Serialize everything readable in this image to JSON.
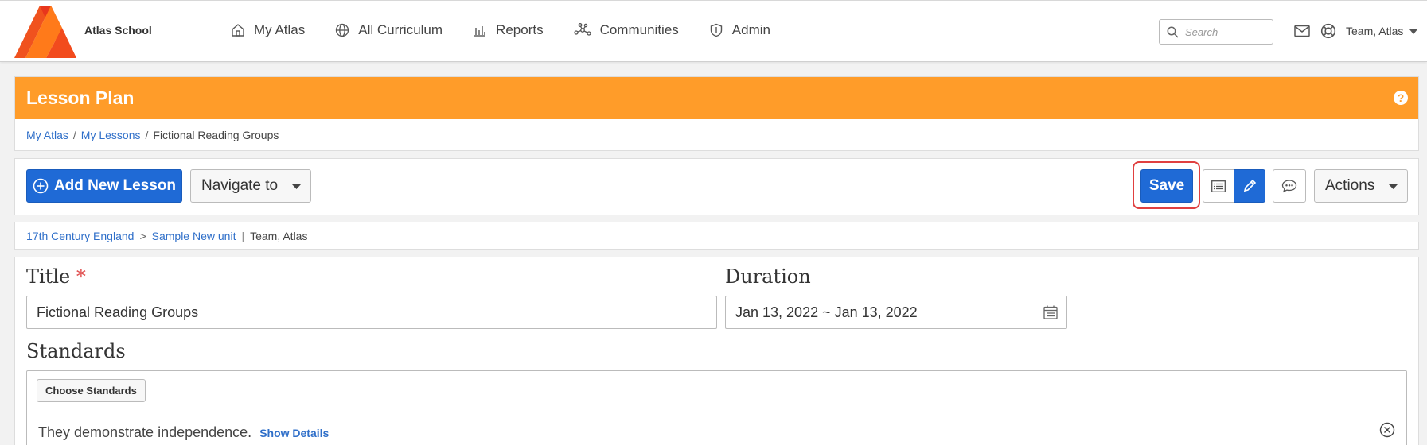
{
  "brand": {
    "school_name": "Atlas School",
    "logo_colors": [
      "#e8361c",
      "#ff7a1a"
    ]
  },
  "nav": {
    "items": [
      {
        "label": "My Atlas",
        "icon": "home-icon"
      },
      {
        "label": "All Curriculum",
        "icon": "globe-icon"
      },
      {
        "label": "Reports",
        "icon": "bar-chart-icon"
      },
      {
        "label": "Communities",
        "icon": "network-icon"
      },
      {
        "label": "Admin",
        "icon": "shield-icon"
      }
    ],
    "search_placeholder": "Search",
    "user_name": "Team, Atlas"
  },
  "header": {
    "title": "Lesson Plan",
    "accent_color": "#ff9c29",
    "breadcrumb": [
      "My Atlas",
      "My Lessons",
      "Fictional Reading Groups"
    ]
  },
  "toolbar": {
    "add_label": "Add New Lesson",
    "navigate_label": "Navigate to",
    "save_label": "Save",
    "actions_label": "Actions",
    "primary_color": "#1f6ad6"
  },
  "unit_path": {
    "course": "17th Century England",
    "unit": "Sample New unit",
    "team": "Team, Atlas"
  },
  "form": {
    "title_label": "Title",
    "required_mark": "*",
    "title_value": "Fictional Reading Groups",
    "duration_label": "Duration",
    "duration_value": "Jan 13, 2022 ~ Jan 13, 2022",
    "standards_label": "Standards",
    "choose_standards_label": "Choose Standards",
    "standards": [
      {
        "text": "They demonstrate independence.",
        "details_label": "Show Details"
      }
    ]
  }
}
